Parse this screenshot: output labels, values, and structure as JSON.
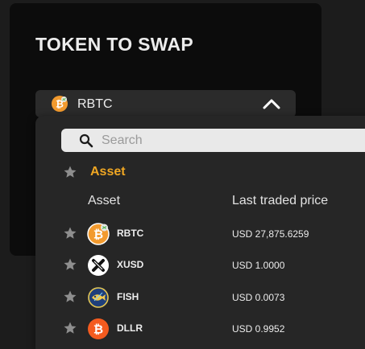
{
  "panel": {
    "title": "TOKEN TO SWAP"
  },
  "selector": {
    "selected_token": "RBTC",
    "icon": "rbtc-coin-icon",
    "chevron": "chevron-up-icon"
  },
  "dropdown": {
    "search": {
      "placeholder": "Search",
      "value": ""
    },
    "favorites_label": "Asset",
    "columns": {
      "asset": "Asset",
      "price": "Last traded price"
    },
    "rows": [
      {
        "symbol": "RBTC",
        "price": "USD 27,875.6259",
        "icon": "rbtc-coin-icon"
      },
      {
        "symbol": "XUSD",
        "price": "USD 1.0000",
        "icon": "xusd-coin-icon"
      },
      {
        "symbol": "FISH",
        "price": "USD 0.0073",
        "icon": "fish-coin-icon"
      },
      {
        "symbol": "DLLR",
        "price": "USD 0.9952",
        "icon": "dllr-coin-icon"
      }
    ]
  },
  "colors": {
    "accent": "#f0a723",
    "rbtc_orange": "#f29a2e",
    "dllr_orange": "#f45b1f",
    "background": "#1c1c1c",
    "panel": "#0c0c0c",
    "dropdown": "#262626"
  }
}
